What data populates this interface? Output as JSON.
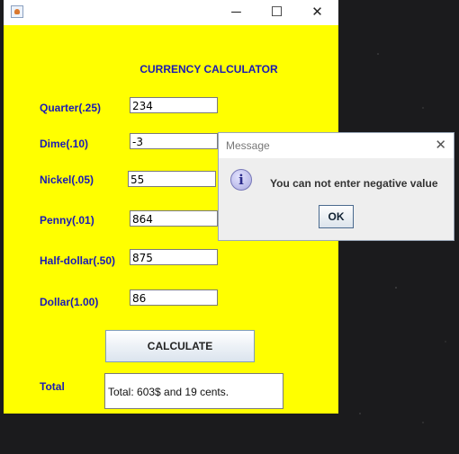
{
  "window": {
    "title_bar": {
      "minimize": "─",
      "maximize": "☐",
      "close": "✕",
      "icon": "java-app-icon"
    },
    "heading": "CURRENCY CALCULATOR"
  },
  "fields": [
    {
      "label": "Quarter(.25)",
      "value": "234"
    },
    {
      "label": "Dime(.10)",
      "value": "-3"
    },
    {
      "label": "Nickel(.05)",
      "value": "55"
    },
    {
      "label": "Penny(.01)",
      "value": "864"
    },
    {
      "label": "Half-dollar(.50)",
      "value": "875"
    },
    {
      "label": "Dollar(1.00)",
      "value": "86"
    }
  ],
  "calculate_label": "CALCULATE",
  "total": {
    "label": "Total",
    "value": "Total: 603$ and 19 cents."
  },
  "dialog": {
    "title": "Message",
    "close": "✕",
    "icon": "info-icon",
    "icon_glyph": "i",
    "message": "You can not enter negative value",
    "ok_label": "OK"
  },
  "colors": {
    "window_bg": "#ffff00",
    "label_text": "#1a1ab5",
    "desktop_bg": "#1b1b1d"
  }
}
